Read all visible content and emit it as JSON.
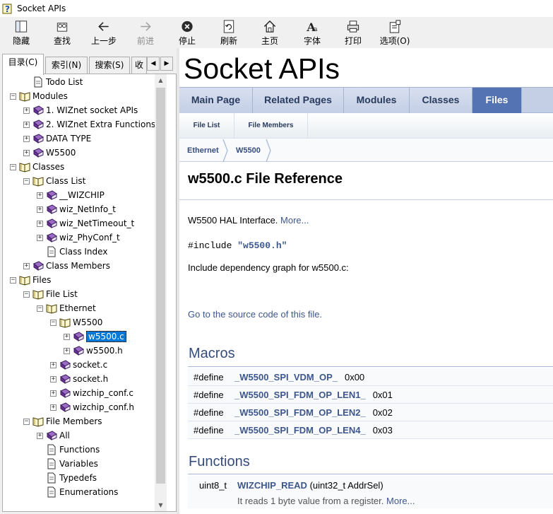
{
  "window": {
    "title": "Socket APIs"
  },
  "toolbar": {
    "buttons": [
      {
        "label": "隐藏",
        "icon": "hide-icon",
        "enabled": true
      },
      {
        "label": "查找",
        "icon": "find-icon",
        "enabled": true
      },
      {
        "label": "上一步",
        "icon": "back-arrow-icon",
        "enabled": true
      },
      {
        "label": "前进",
        "icon": "forward-arrow-icon",
        "enabled": false
      },
      {
        "label": "停止",
        "icon": "stop-icon",
        "enabled": true
      },
      {
        "label": "刷新",
        "icon": "refresh-icon",
        "enabled": true
      },
      {
        "label": "主页",
        "icon": "home-icon",
        "enabled": true
      },
      {
        "label": "字体",
        "icon": "font-icon",
        "enabled": true
      },
      {
        "label": "打印",
        "icon": "print-icon",
        "enabled": true
      },
      {
        "label": "选项(O)",
        "icon": "options-icon",
        "enabled": true
      }
    ]
  },
  "nav_tabs": [
    {
      "label": "目录(C)",
      "active": true
    },
    {
      "label": "索引(N)",
      "active": false
    },
    {
      "label": "搜索(S)",
      "active": false
    },
    {
      "label": "收",
      "active": false
    }
  ],
  "tree": {
    "items": [
      {
        "label": "Todo List",
        "level": 1,
        "type": "page",
        "expander": ""
      },
      {
        "label": "Modules",
        "level": 0,
        "type": "book-open",
        "expander": "−"
      },
      {
        "label": "1. WIZnet socket APIs",
        "level": 1,
        "type": "book-closed",
        "expander": "+"
      },
      {
        "label": "2. WIZnet Extra Functions",
        "level": 1,
        "type": "book-closed",
        "expander": "+"
      },
      {
        "label": "DATA TYPE",
        "level": 1,
        "type": "book-closed",
        "expander": "+"
      },
      {
        "label": "W5500",
        "level": 1,
        "type": "book-closed",
        "expander": "+"
      },
      {
        "label": "Classes",
        "level": 0,
        "type": "book-open",
        "expander": "−"
      },
      {
        "label": "Class List",
        "level": 1,
        "type": "book-open",
        "expander": "−"
      },
      {
        "label": "__WIZCHIP",
        "level": 2,
        "type": "book-closed",
        "expander": "+"
      },
      {
        "label": "wiz_NetInfo_t",
        "level": 2,
        "type": "book-closed",
        "expander": "+"
      },
      {
        "label": "wiz_NetTimeout_t",
        "level": 2,
        "type": "book-closed",
        "expander": "+"
      },
      {
        "label": "wiz_PhyConf_t",
        "level": 2,
        "type": "book-closed",
        "expander": "+"
      },
      {
        "label": "Class Index",
        "level": 2,
        "type": "page",
        "expander": ""
      },
      {
        "label": "Class Members",
        "level": 1,
        "type": "book-closed",
        "expander": "+"
      },
      {
        "label": "Files",
        "level": 0,
        "type": "book-open",
        "expander": "−"
      },
      {
        "label": "File List",
        "level": 1,
        "type": "book-open",
        "expander": "−"
      },
      {
        "label": "Ethernet",
        "level": 2,
        "type": "book-open",
        "expander": "−"
      },
      {
        "label": "W5500",
        "level": 3,
        "type": "book-open",
        "expander": "−"
      },
      {
        "label": "w5500.c",
        "level": 4,
        "type": "book-closed",
        "expander": "+",
        "selected": true
      },
      {
        "label": "w5500.h",
        "level": 4,
        "type": "book-closed",
        "expander": "+"
      },
      {
        "label": "socket.c",
        "level": 3,
        "type": "book-closed",
        "expander": "+"
      },
      {
        "label": "socket.h",
        "level": 3,
        "type": "book-closed",
        "expander": "+"
      },
      {
        "label": "wizchip_conf.c",
        "level": 3,
        "type": "book-closed",
        "expander": "+"
      },
      {
        "label": "wizchip_conf.h",
        "level": 3,
        "type": "book-closed",
        "expander": "+"
      },
      {
        "label": "File Members",
        "level": 1,
        "type": "book-open",
        "expander": "−"
      },
      {
        "label": "All",
        "level": 2,
        "type": "book-closed",
        "expander": "+"
      },
      {
        "label": "Functions",
        "level": 2,
        "type": "page",
        "expander": ""
      },
      {
        "label": "Variables",
        "level": 2,
        "type": "page",
        "expander": ""
      },
      {
        "label": "Typedefs",
        "level": 2,
        "type": "page",
        "expander": ""
      },
      {
        "label": "Enumerations",
        "level": 2,
        "type": "page",
        "expander": ""
      }
    ]
  },
  "content": {
    "project_title": "Socket APIs",
    "main_nav": [
      {
        "label": "Main Page",
        "current": false
      },
      {
        "label": "Related Pages",
        "current": false
      },
      {
        "label": "Modules",
        "current": false
      },
      {
        "label": "Classes",
        "current": false
      },
      {
        "label": "Files",
        "current": true
      }
    ],
    "sub_nav": [
      "File List",
      "File Members"
    ],
    "breadcrumb": [
      "Ethernet",
      "W5500"
    ],
    "headline": "w5500.c File Reference",
    "brief": "W5500 HAL Interface.",
    "more_link": "More...",
    "include_prefix": "#include ",
    "include_file": "\"w5500.h\"",
    "include_graph": "Include dependency graph for w5500.c:",
    "source_link": "Go to the source code of this file.",
    "macros_title": "Macros",
    "macros": [
      {
        "kw": "#define",
        "name": "_W5500_SPI_VDM_OP_",
        "value": "0x00"
      },
      {
        "kw": "#define",
        "name": "_W5500_SPI_FDM_OP_LEN1_",
        "value": "0x01"
      },
      {
        "kw": "#define",
        "name": "_W5500_SPI_FDM_OP_LEN2_",
        "value": "0x02"
      },
      {
        "kw": "#define",
        "name": "_W5500_SPI_FDM_OP_LEN4_",
        "value": "0x03"
      }
    ],
    "functions_title": "Functions",
    "functions": [
      {
        "type": "uint8_t",
        "name": "WIZCHIP_READ",
        "args": "(uint32_t AddrSel)",
        "desc": "It reads 1 byte value from a register.",
        "more": "More..."
      }
    ]
  }
}
